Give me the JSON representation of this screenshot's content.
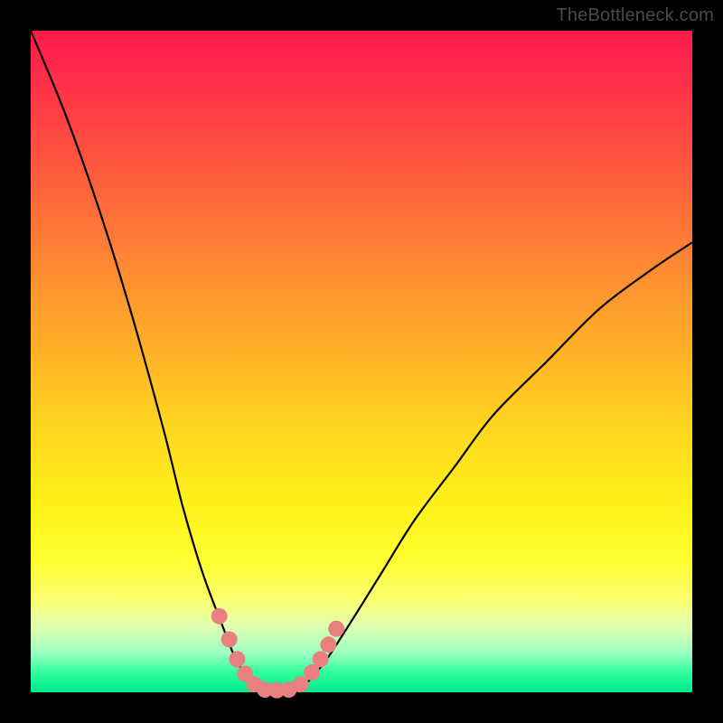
{
  "attribution": "TheBottleneck.com",
  "colors": {
    "frame": "#000000",
    "gradient_top": "#ff1a4a",
    "gradient_bottom": "#00e88a",
    "curve": "#000000",
    "marker": "#e98080"
  },
  "chart_data": {
    "type": "line",
    "title": "",
    "xlabel": "",
    "ylabel": "",
    "xlim": [
      0,
      100
    ],
    "ylim": [
      0,
      100
    ],
    "series": [
      {
        "name": "bottleneck-curve",
        "x": [
          0,
          5,
          10,
          15,
          20,
          23,
          26,
          29,
          31,
          33,
          35,
          37,
          40,
          44,
          48,
          53,
          58,
          64,
          70,
          78,
          86,
          94,
          100
        ],
        "values": [
          100,
          88,
          74,
          58,
          40,
          28,
          18,
          10,
          5,
          2,
          0,
          0,
          0,
          4,
          10,
          18,
          26,
          34,
          42,
          50,
          58,
          64,
          68
        ]
      }
    ],
    "markers": {
      "name": "highlighted-points",
      "x": [
        28.5,
        30.0,
        31.2,
        32.4,
        33.8,
        35.4,
        37.2,
        39.0,
        40.8,
        42.5,
        43.8,
        45.0,
        46.2
      ],
      "values": [
        11.5,
        8.0,
        5.0,
        2.8,
        1.2,
        0.4,
        0.3,
        0.4,
        1.2,
        3.0,
        5.0,
        7.2,
        9.6
      ]
    }
  }
}
